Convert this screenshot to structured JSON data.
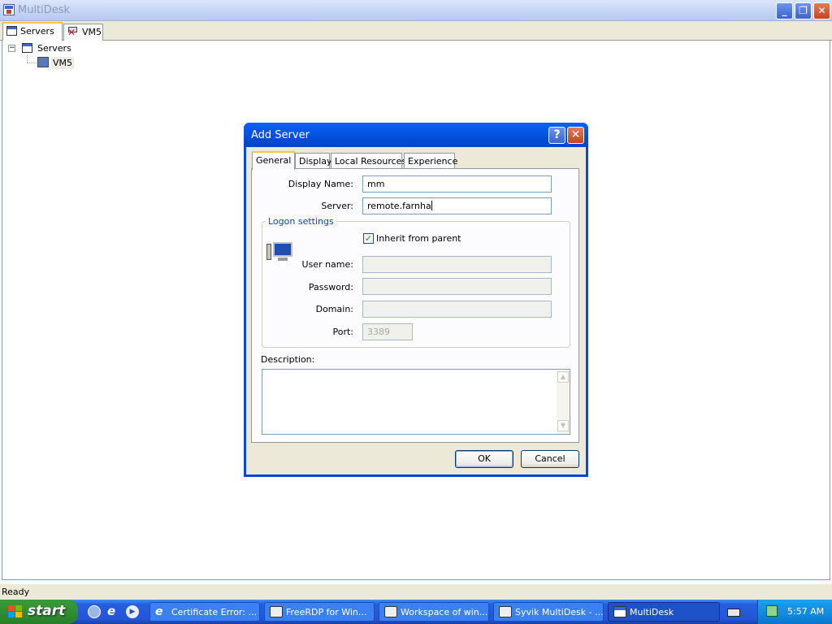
{
  "window": {
    "title": "MultiDesk",
    "minimize_glyph": "_",
    "maximize_glyph": "❐",
    "close_glyph": "✕"
  },
  "tabs": [
    {
      "label": "Servers",
      "icon": "servers-icon"
    },
    {
      "label": "VM5",
      "icon": "disconnected-server-icon"
    }
  ],
  "tree": {
    "root": "Servers",
    "expander": "−",
    "children": [
      "VM5"
    ]
  },
  "status": "Ready",
  "dialog": {
    "title": "Add Server",
    "help_glyph": "?",
    "close_glyph": "✕",
    "tabs": [
      "General",
      "Display",
      "Local Resources",
      "Experience"
    ],
    "active_tab": "General",
    "display_name_label": "Display Name:",
    "display_name_value": "mm",
    "server_label": "Server:",
    "server_value": "remote.farnha",
    "logon_group": "Logon settings",
    "inherit_label": "Inherit from parent",
    "inherit_checked": "✓",
    "username_label": "User name:",
    "username_value": "",
    "password_label": "Password:",
    "password_value": "",
    "domain_label": "Domain:",
    "domain_value": "",
    "port_label": "Port:",
    "port_value": "3389",
    "description_label": "Description:",
    "description_value": "",
    "ok": "OK",
    "cancel": "Cancel"
  },
  "taskbar": {
    "start": "start",
    "items": [
      {
        "label": "Certificate Error: ...",
        "icon": "ie-icon"
      },
      {
        "label": "FreeRDP for Win...",
        "icon": "app-icon"
      },
      {
        "label": "Workspace of win...",
        "icon": "app-icon"
      },
      {
        "label": "Syvik MultiDesk - ...",
        "icon": "app-icon"
      },
      {
        "label": "MultiDesk",
        "icon": "multidesk-icon"
      }
    ],
    "clock": "5:57 AM"
  },
  "colors": {
    "xp_blue": "#0a46d8",
    "start_green": "#2f8f2f",
    "tab_highlight": "#ffc83c"
  }
}
